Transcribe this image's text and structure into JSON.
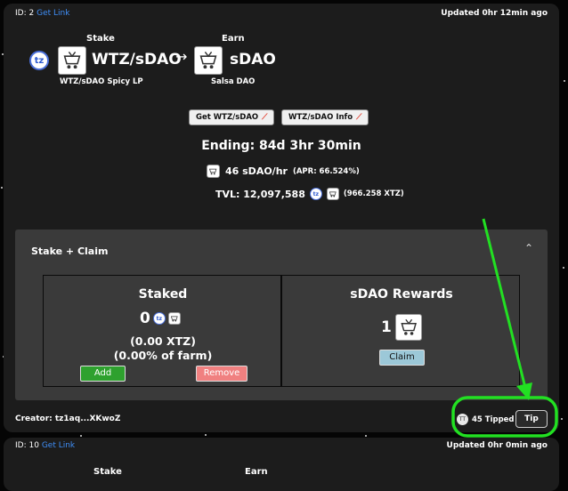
{
  "farm1": {
    "id_label": "ID: 2",
    "get_link": "Get Link",
    "updated": "Updated 0hr 12min ago",
    "stake_label": "Stake",
    "earn_label": "Earn",
    "stake_token": "WTZ/sDAO",
    "stake_token_sub": "WTZ/sDAO Spicy LP",
    "earn_token": "sDAO",
    "earn_token_sub": "Salsa DAO",
    "arrow": "→",
    "btn_get": "Get WTZ/sDAO",
    "btn_info": "WTZ/sDAO Info",
    "ending": "Ending: 84d 3hr 30min",
    "rate": "46 sDAO/hr",
    "apr": "(APR: 66.524%)",
    "tvl": "TVL: 12,097,588",
    "tvl_xtz": "(966.258 XTZ)",
    "tz_glyph": "tz",
    "panel": {
      "title": "Stake + Claim",
      "staked_title": "Staked",
      "staked_amount": "0",
      "staked_xtz": "(0.00 XTZ)",
      "staked_pct": "(0.00% of farm)",
      "add": "Add",
      "remove": "Remove",
      "rewards_title": "sDAO Rewards",
      "rewards_amount": "1",
      "claim": "Claim"
    },
    "creator": "Creator: tz1aq...XKwoZ",
    "tipped": "45 Tipped",
    "tip": "Tip"
  },
  "farm2": {
    "id_label": "ID: 10",
    "get_link": "Get Link",
    "updated": "Updated 0hr 0min ago",
    "stake_label": "Stake",
    "earn_label": "Earn"
  },
  "colors": {
    "link": "#3f8ef6",
    "annotation": "#22e022",
    "add": "#2ea12e",
    "remove": "#f08080",
    "claim": "#9cc8d8"
  }
}
